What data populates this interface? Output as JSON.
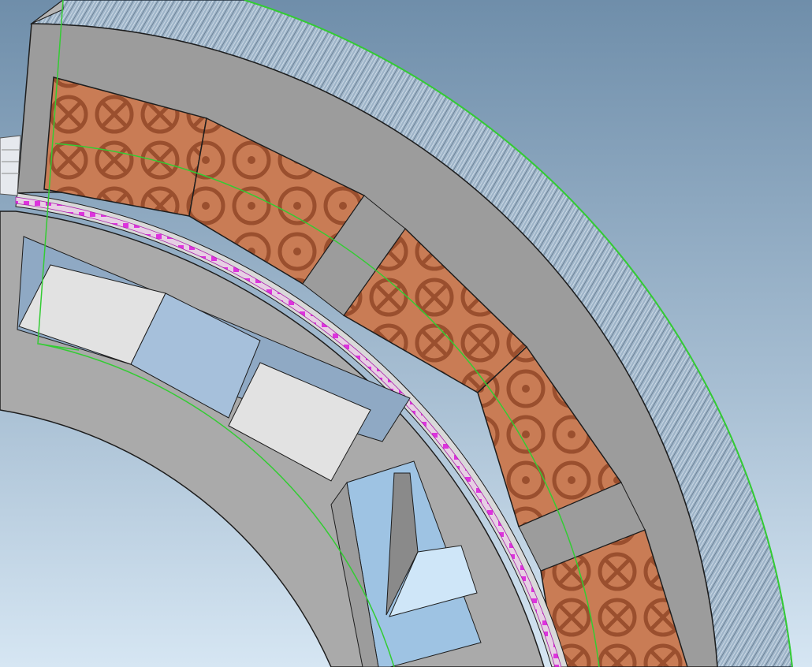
{
  "scene": {
    "kind": "3d-cad-viewport",
    "subject": "electric-machine-stator-rotor-quarter-section",
    "colors": {
      "background_top": "#6f8eaa",
      "background_bottom": "#d6e6f3",
      "core": "#9c9c9c",
      "core_edge": "#1d1d1d",
      "coil": "#c87a52",
      "coil_pattern": "#9a4f2e",
      "fins": "#9cb2c6",
      "fins_dark": "#2c3a48",
      "magenta_band": "#dd33dd",
      "guide_line": "#33cc33",
      "cavity_light": "#e2e2e2",
      "cavity_blue": "#a6c0db"
    },
    "coil_blocks": [
      "coil-block-1",
      "coil-block-2",
      "coil-block-3",
      "coil-block-4",
      "coil-block-5"
    ]
  }
}
